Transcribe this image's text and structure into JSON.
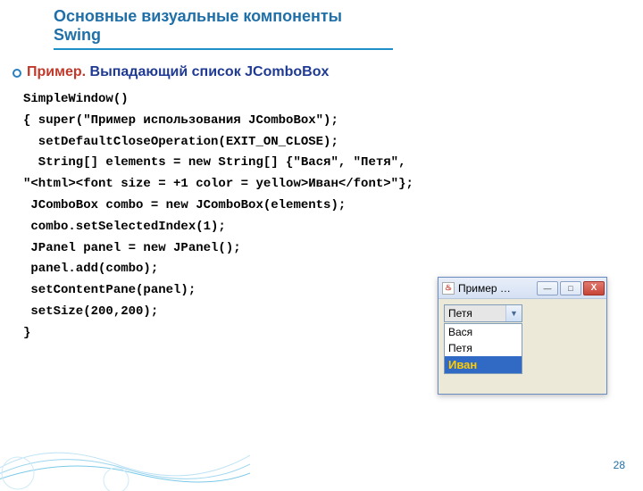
{
  "title": "Основные визуальные компоненты Swing",
  "example": {
    "word": "Пример.",
    "desc": " Выпадающий список JComboBox"
  },
  "code": "SimpleWindow()\n{ super(\"Пример использования JComboBox\");\n  setDefaultCloseOperation(EXIT_ON_CLOSE);\n  String[] elements = new String[] {\"Вася\", \"Петя\",\n\"<html><font size = +1 color = yellow>Иван</font>\"};\n JComboBox combo = new JComboBox(elements);\n combo.setSelectedIndex(1);\n JPanel panel = new JPanel();\n panel.add(combo);\n setContentPane(panel);\n setSize(200,200);\n}",
  "window": {
    "title": "Пример …",
    "java_glyph": "♨",
    "min": "—",
    "max": "□",
    "close": "X",
    "selected": "Петя",
    "arrow": "▼",
    "options": {
      "o0": "Вася",
      "o1": "Петя",
      "o2": "Иван"
    }
  },
  "page": "28"
}
